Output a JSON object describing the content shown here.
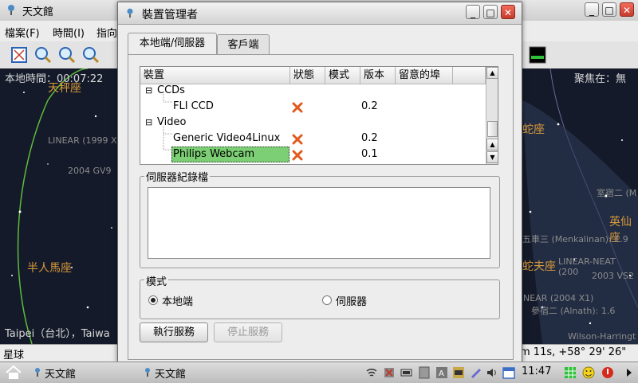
{
  "main_window": {
    "title": "天文館",
    "menu": [
      "檔案(F)",
      "時間(I)",
      "指向"
    ],
    "time_label": "本地時間：00:07:22",
    "focus_label": "聚焦在：無",
    "location_label": "Taipei（台北），Taiwa",
    "coord_readout": "m 11s, +58° 29' 26\"",
    "status_text": "星球",
    "sky_labels": [
      {
        "text": "天秤座",
        "bright": true
      },
      {
        "text": "半人馬座",
        "bright": true
      },
      {
        "text": "LINEAR (1999 X",
        "bright": false
      },
      {
        "text": "2004 GV9",
        "bright": false
      },
      {
        "text": "蛇座",
        "bright": true
      },
      {
        "text": "英仙座",
        "bright": true
      },
      {
        "text": "蛇夫座",
        "bright": true
      },
      {
        "text": "LINEAR-NEAT (200",
        "bright": false
      },
      {
        "text": "2003 VS2",
        "bright": false
      },
      {
        "text": "NEAR (2004 X1)",
        "bright": false
      },
      {
        "text": "參宿二 (Alnath): 1.6",
        "bright": false
      },
      {
        "text": "五車三 (Menkalinan): 1.9",
        "bright": false
      },
      {
        "text": "室宿二 (M",
        "bright": false
      },
      {
        "text": "Wilson-Harringt",
        "bright": false
      }
    ]
  },
  "dialog": {
    "title": "裝置管理者",
    "tabs": [
      "本地端/伺服器",
      "客戶端"
    ],
    "columns": [
      "裝置",
      "狀態",
      "模式",
      "版本",
      "留意的埠"
    ],
    "rows": [
      {
        "type": "group",
        "label": "CCDs"
      },
      {
        "type": "device",
        "label": "FLI CCD",
        "status": "x",
        "version": "0.2"
      },
      {
        "type": "group",
        "label": "Video"
      },
      {
        "type": "device",
        "label": "Generic Video4Linux",
        "status": "x",
        "version": "0.2"
      },
      {
        "type": "device",
        "label": "Philips Webcam",
        "status": "x",
        "version": "0.1",
        "selected": true
      }
    ],
    "server_log_label": "伺服器紀錄檔",
    "server_log_text": "",
    "mode_label": "模式",
    "mode_options": [
      "本地端",
      "伺服器"
    ],
    "mode_selected": "本地端",
    "run_button": "執行服務",
    "stop_button": "停止服務"
  },
  "taskbar": {
    "items": [
      "天文館",
      "天文館"
    ],
    "clock": "11:47"
  },
  "colors": {
    "selection": "#7ccf74",
    "status_x": "#e25a1c"
  }
}
